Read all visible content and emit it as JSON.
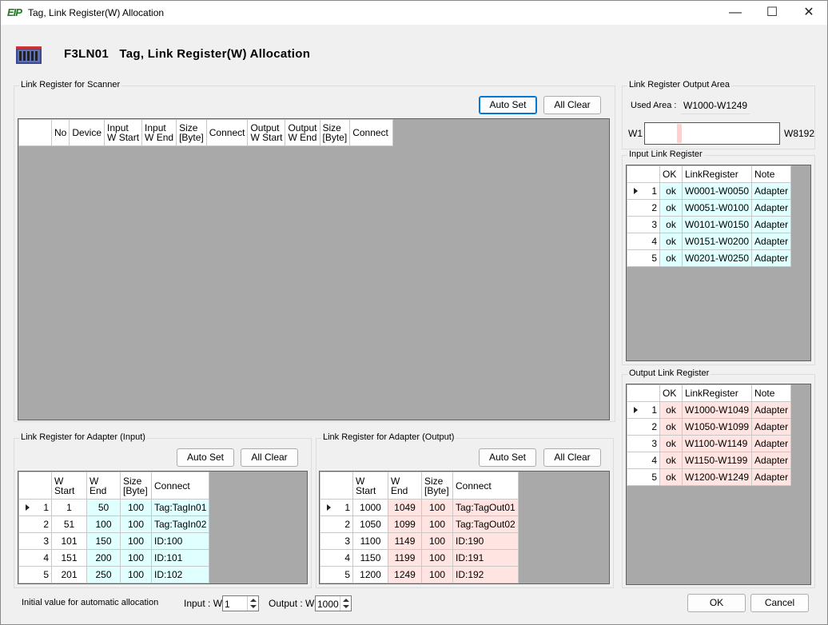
{
  "window": {
    "title": "Tag, Link Register(W) Allocation",
    "icon_text": "EIP",
    "minimize_glyph": "—",
    "maximize_glyph": "☐",
    "close_glyph": "✕"
  },
  "header": {
    "title": "F3LN01   Tag, Link Register(W) Allocation"
  },
  "scanner": {
    "group_label": "Link Register for Scanner",
    "auto_set": "Auto Set",
    "all_clear": "All Clear",
    "columns": [
      {
        "l1": "No",
        "l2": ""
      },
      {
        "l1": "Device",
        "l2": ""
      },
      {
        "l1": "Input",
        "l2": "W Start"
      },
      {
        "l1": "Input",
        "l2": "W End"
      },
      {
        "l1": "Size",
        "l2": "[Byte]"
      },
      {
        "l1": "Connect",
        "l2": ""
      },
      {
        "l1": "Output",
        "l2": "W Start"
      },
      {
        "l1": "Output",
        "l2": "W End"
      },
      {
        "l1": "Size",
        "l2": "[Byte]"
      },
      {
        "l1": "Connect",
        "l2": ""
      }
    ]
  },
  "adapter_input": {
    "group_label": "Link Register for Adapter (Input)",
    "auto_set": "Auto Set",
    "all_clear": "All Clear",
    "columns": [
      {
        "l1": "W",
        "l2": "Start"
      },
      {
        "l1": "W",
        "l2": "End"
      },
      {
        "l1": "Size",
        "l2": "[Byte]"
      },
      {
        "l1": "Connect",
        "l2": ""
      }
    ],
    "rows": [
      {
        "n": "1",
        "start": "1",
        "end": "50",
        "size": "100",
        "connect": "Tag:TagIn01"
      },
      {
        "n": "2",
        "start": "51",
        "end": "100",
        "size": "100",
        "connect": "Tag:TagIn02"
      },
      {
        "n": "3",
        "start": "101",
        "end": "150",
        "size": "100",
        "connect": "ID:100"
      },
      {
        "n": "4",
        "start": "151",
        "end": "200",
        "size": "100",
        "connect": "ID:101"
      },
      {
        "n": "5",
        "start": "201",
        "end": "250",
        "size": "100",
        "connect": "ID:102"
      }
    ]
  },
  "adapter_output": {
    "group_label": "Link Register for Adapter (Output)",
    "auto_set": "Auto Set",
    "all_clear": "All Clear",
    "columns": [
      {
        "l1": "W",
        "l2": "Start"
      },
      {
        "l1": "W",
        "l2": "End"
      },
      {
        "l1": "Size",
        "l2": "[Byte]"
      },
      {
        "l1": "Connect",
        "l2": ""
      }
    ],
    "rows": [
      {
        "n": "1",
        "start": "1000",
        "end": "1049",
        "size": "100",
        "connect": "Tag:TagOut01"
      },
      {
        "n": "2",
        "start": "1050",
        "end": "1099",
        "size": "100",
        "connect": "Tag:TagOut02"
      },
      {
        "n": "3",
        "start": "1100",
        "end": "1149",
        "size": "100",
        "connect": "ID:190"
      },
      {
        "n": "4",
        "start": "1150",
        "end": "1199",
        "size": "100",
        "connect": "ID:191"
      },
      {
        "n": "5",
        "start": "1200",
        "end": "1249",
        "size": "100",
        "connect": "ID:192"
      }
    ]
  },
  "output_area": {
    "group_label": "Link Register Output Area",
    "used_area_label": "Used Area :",
    "used_area_value": "W1000-W1249",
    "range_min": "W1",
    "range_max": "W8192",
    "used_start": 1000,
    "used_end": 1249,
    "range_total": 8192
  },
  "input_link": {
    "group_label": "Input Link Register",
    "columns": [
      "OK",
      "LinkRegister",
      "Note"
    ],
    "rows": [
      {
        "n": "1",
        "ok": "ok",
        "reg": "W0001-W0050",
        "note": "Adapter"
      },
      {
        "n": "2",
        "ok": "ok",
        "reg": "W0051-W0100",
        "note": "Adapter"
      },
      {
        "n": "3",
        "ok": "ok",
        "reg": "W0101-W0150",
        "note": "Adapter"
      },
      {
        "n": "4",
        "ok": "ok",
        "reg": "W0151-W0200",
        "note": "Adapter"
      },
      {
        "n": "5",
        "ok": "ok",
        "reg": "W0201-W0250",
        "note": "Adapter"
      }
    ]
  },
  "output_link": {
    "group_label": "Output Link Register",
    "columns": [
      "OK",
      "LinkRegister",
      "Note"
    ],
    "rows": [
      {
        "n": "1",
        "ok": "ok",
        "reg": "W1000-W1049",
        "note": "Adapter"
      },
      {
        "n": "2",
        "ok": "ok",
        "reg": "W1050-W1099",
        "note": "Adapter"
      },
      {
        "n": "3",
        "ok": "ok",
        "reg": "W1100-W1149",
        "note": "Adapter"
      },
      {
        "n": "4",
        "ok": "ok",
        "reg": "W1150-W1199",
        "note": "Adapter"
      },
      {
        "n": "5",
        "ok": "ok",
        "reg": "W1200-W1249",
        "note": "Adapter"
      }
    ]
  },
  "footer": {
    "initial_label": "Initial value for automatic allocation",
    "input_label": "Input : W",
    "input_value": "1",
    "output_label": "Output : W",
    "output_value": "1000",
    "ok": "OK",
    "cancel": "Cancel"
  },
  "colors": {
    "input_cell": "#e0ffff",
    "output_cell": "#ffe4e1",
    "grid_bg": "#a9a9a9"
  }
}
